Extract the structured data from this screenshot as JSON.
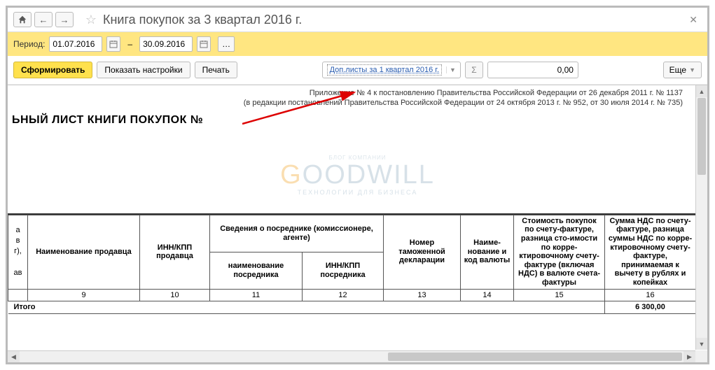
{
  "title": "Книга покупок за 3 квартал 2016 г.",
  "period": {
    "label": "Период:",
    "from": "01.07.2016",
    "dash": "–",
    "to": "30.09.2016"
  },
  "toolbar": {
    "generate": "Сформировать",
    "show_settings": "Показать настройки",
    "print": "Печать",
    "dropdown_selected": "Доп.листы за 1 квартал 2016 г.",
    "sigma": "Σ",
    "sum_value": "0,00",
    "more": "Еще"
  },
  "regulation": {
    "line1": "Приложение № 4 к постановлению Правительства Российской Федерации от 26 декабря 2011 г. № 1137",
    "line2": "(в редакции постановлений Правительства Российской Федерации от 24 октября 2013 г. № 952, от 30 июля 2014 г. № 735)"
  },
  "document": {
    "heading": "ЬНЫЙ  ЛИСТ  КНИГИ ПОКУПОК   №"
  },
  "watermark": {
    "top": "БЛОГ КОМПАНИИ",
    "main_g": "G",
    "main_rest": "OODWILL",
    "sub": "ТЕХНОЛОГИИ   ДЛЯ   БИЗНЕСА"
  },
  "table": {
    "headers": {
      "col8": "а\nв\nг),\nав",
      "col9": "Наименование продавца",
      "col10": "ИНН/КПП продавца",
      "col11_top": "Сведения о посреднике (комиссионере, агенте)",
      "col11": "наименование посредника",
      "col12": "ИНН/КПП посредника",
      "col13": "Номер таможенной декларации",
      "col14": "Наиме-нование и код валюты",
      "col15": "Стоимость покупок по счету-фактуре, разница сто-имости по корре-ктировочному счету-фактуре (включая НДС) в валюте счета-фактуры",
      "col16": "Сумма НДС по счету-фактуре, разница суммы НДС по корре-ктировочному счету-фактуре, принимаемая к вычету в рублях и копейках"
    },
    "col_nums": [
      "9",
      "10",
      "11",
      "12",
      "13",
      "14",
      "15",
      "16"
    ],
    "total_label": "Итого",
    "total_value": "6 300,00"
  }
}
